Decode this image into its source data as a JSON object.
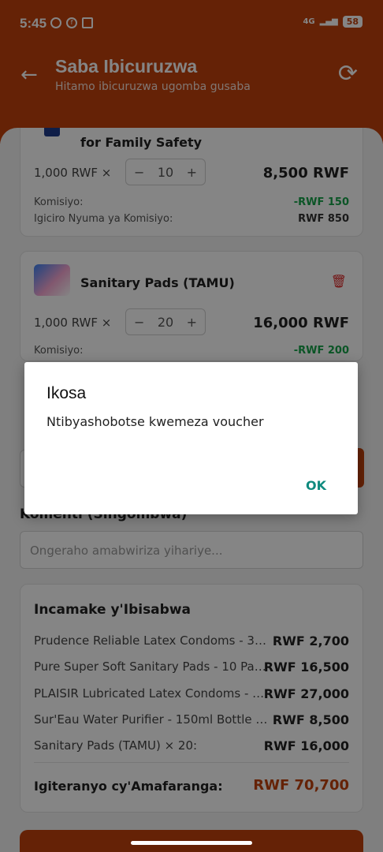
{
  "status": {
    "time": "5:45",
    "network": "4G",
    "battery": "58"
  },
  "header": {
    "back_icon": "arrow-left-icon",
    "title": "Saba Ibicuruzwa",
    "subtitle": "Hitamo ibicuruzwa ugomba gusaba",
    "refresh_icon": "refresh-icon"
  },
  "items": [
    {
      "name": "for Family Safety",
      "unit_price": "1,000 RWF ×",
      "qty": "10",
      "total": "8,500 RWF",
      "commission_label": "Komisiyo:",
      "commission": "-RWF 150",
      "after_label": "Igiciro Nyuma ya Komisiyo:",
      "after": "RWF 850"
    },
    {
      "name": "Sanitary Pads (TAMU)",
      "unit_price": "1,000 RWF ×",
      "qty": "20",
      "total": "16,000 RWF",
      "commission_label": "Komisiyo:",
      "commission": "-RWF 200"
    }
  ],
  "stepper": {
    "minus": "−",
    "plus": "+"
  },
  "notes": {
    "label": "Komenti (Singombwa)",
    "placeholder": "Ongeraho amabwiriza yihariye..."
  },
  "summary": {
    "title": "Incamake y'Ibisabwa",
    "rows": [
      {
        "name": "Prudence Reliable Latex Condoms - 3-P...",
        "amount": "RWF 2,700"
      },
      {
        "name": "Pure Super Soft Sanitary Pads - 10 Pac...",
        "amount": "RWF 16,500"
      },
      {
        "name": "PLAISIR Lubricated Latex Condoms - 3-...",
        "amount": "RWF 27,000"
      },
      {
        "name": "Sur'Eau Water Purifier - 150ml Bottle fo...",
        "amount": "RWF 8,500"
      },
      {
        "name": "Sanitary Pads (TAMU) × 20:",
        "amount": "RWF 16,000"
      }
    ],
    "total_label": "Igiteranyo cy'Amafaranga:",
    "total_value": "RWF 70,700"
  },
  "dialog": {
    "title": "Ikosa",
    "message": "Ntibyashobotse kwemeza voucher",
    "ok": "OK"
  }
}
